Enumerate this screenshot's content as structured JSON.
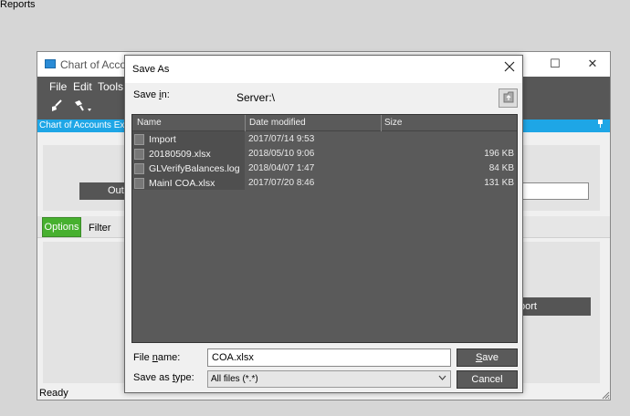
{
  "desktop": {
    "label": "Reports"
  },
  "app": {
    "title": "Chart of Accou",
    "window_buttons": {
      "minimize": "—",
      "maximize": "☐",
      "close": "✕"
    },
    "menu": [
      "File",
      "Edit",
      "Tools"
    ],
    "subheader": "Chart of Accounts Ex",
    "pin": "🖈",
    "output_button": "Outp",
    "tabs": {
      "options": "Options",
      "filter": "Filter"
    },
    "report_button": "port",
    "status": "Ready"
  },
  "dialog": {
    "title": "Save As",
    "save_in_label": "Save in:",
    "save_in_value": "Server:\\",
    "columns": {
      "name": "Name",
      "date": "Date modified",
      "size": "Size"
    },
    "files": [
      {
        "name": "Import",
        "date": "2017/07/14 9:53",
        "size": ""
      },
      {
        "name": "20180509.xlsx",
        "date": "2018/05/10 9:06",
        "size": "196 KB"
      },
      {
        "name": "GLVerifyBalances.log",
        "date": "2018/04/07 1:47",
        "size": "84 KB"
      },
      {
        "name": "MainI COA.xlsx",
        "date": "2017/07/20 8:46",
        "size": "131 KB"
      }
    ],
    "file_name_label": "File name:",
    "file_name_value": "COA.xlsx",
    "save_type_label": "Save as type:",
    "save_type_value": "All files (*.*)",
    "save_button": "Save",
    "cancel_button": "Cancel"
  },
  "colors": {
    "accent_blue": "#1ea6e6",
    "tab_green": "#47b02f",
    "dark_gray": "#5a5a5a"
  }
}
